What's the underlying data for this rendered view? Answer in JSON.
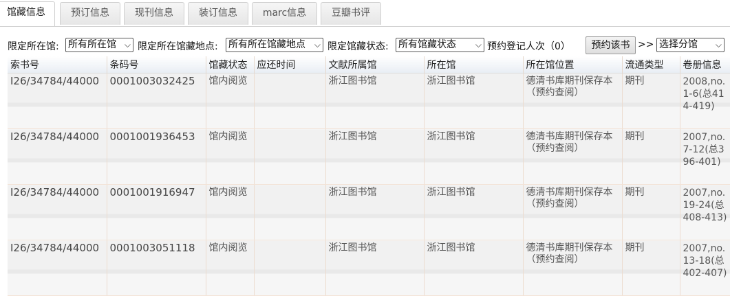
{
  "tabs": [
    "馆藏信息",
    "预订信息",
    "现刊信息",
    "装订信息",
    "marc信息",
    "豆瓣书评"
  ],
  "filters": {
    "library_label": "限定所在馆:",
    "library_value": "所有所在馆",
    "location_label": "限定所在馆藏地点:",
    "location_value": "所有所在馆藏地点",
    "status_label": "限定馆藏状态:",
    "status_value": "所有馆藏状态",
    "reservation_count": "预约登记人次（0）",
    "reserve_button": "预约该书",
    "arrow": ">>",
    "branch_value": "选择分馆"
  },
  "table": {
    "headers": [
      "索书号",
      "条码号",
      "馆藏状态",
      "应还时间",
      "文献所属馆",
      "所在馆",
      "所在馆位置",
      "流通类型",
      "卷册信息"
    ],
    "rows": [
      {
        "call": "I26/34784/44000",
        "barcode": "0001003032425",
        "status": "馆内阅览",
        "due": "",
        "owner": "浙江图书馆",
        "library": "浙江图书馆",
        "location": "德清书库期刊保存本（预约查阅）",
        "type": "期刊",
        "volume": "2008,no.1-6(总414-419)"
      },
      {
        "call": "I26/34784/44000",
        "barcode": "0001001936453",
        "status": "馆内阅览",
        "due": "",
        "owner": "浙江图书馆",
        "library": "浙江图书馆",
        "location": "德清书库期刊保存本（预约查阅）",
        "type": "期刊",
        "volume": "2007,no.7-12(总396-401)"
      },
      {
        "call": "I26/34784/44000",
        "barcode": "0001001916947",
        "status": "馆内阅览",
        "due": "",
        "owner": "浙江图书馆",
        "library": "浙江图书馆",
        "location": "德清书库期刊保存本（预约查阅）",
        "type": "期刊",
        "volume": "2007,no.19-24(总408-413)"
      },
      {
        "call": "I26/34784/44000",
        "barcode": "0001003051118",
        "status": "馆内阅览",
        "due": "",
        "owner": "浙江图书馆",
        "library": "浙江图书馆",
        "location": "德清书库期刊保存本（预约查阅）",
        "type": "期刊",
        "volume": "2007,no.13-18(总402-407)"
      }
    ]
  }
}
